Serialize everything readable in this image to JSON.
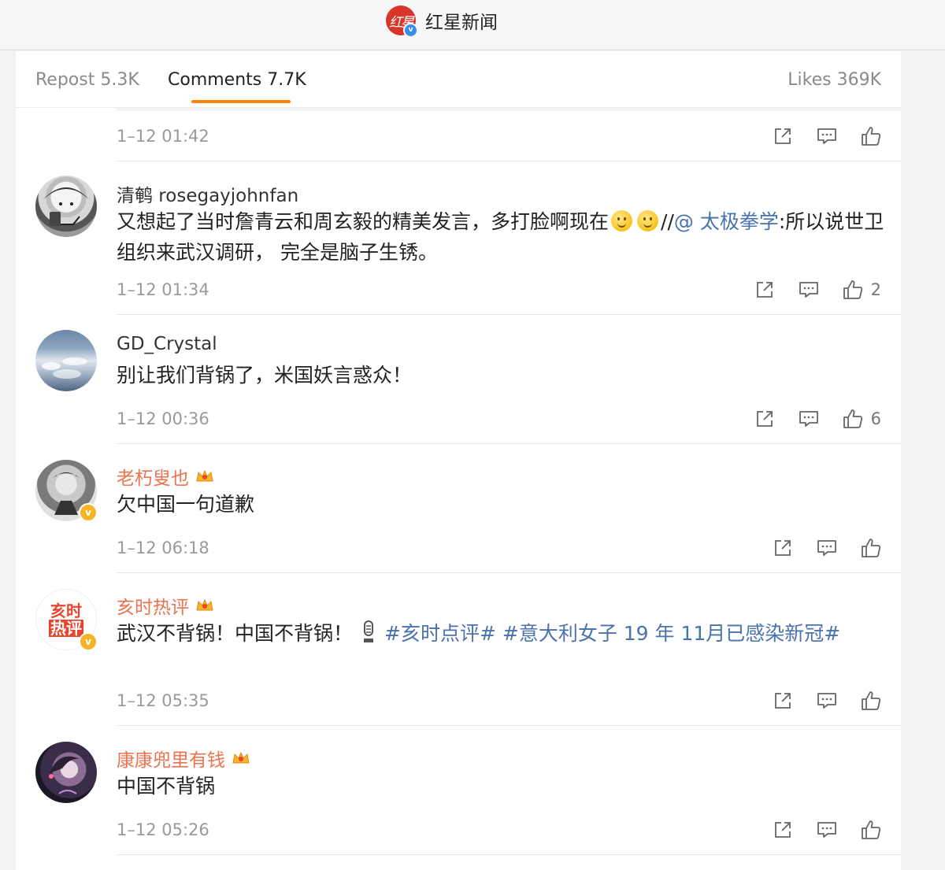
{
  "header": {
    "app_name": "红星新闻",
    "logo_text": "红星",
    "logo_badge": "v"
  },
  "tabs": {
    "repost": "Repost 5.3K",
    "comments": "Comments 7.7K",
    "likes": "Likes 369K",
    "accent_color": "#ff8200"
  },
  "comments": [
    {
      "timestamp": "1–12 01:42",
      "likes": ""
    },
    {
      "username": "清鹌 rosegayjohnfan",
      "text_before": "又想起了当时詹青云和周玄毅的精美发言，多打脸啊现在",
      "emoji": "smile",
      "text_sep": "//",
      "mention": "@ 太极拳学",
      "text_after": ":所以说世卫组织来武汉调研， 完全是脑子生锈。",
      "timestamp": "1–12 01:34",
      "likes": "2"
    },
    {
      "username": "GD_Crystal",
      "text": "别让我们背锅了，米国妖言惑众！",
      "timestamp": "1–12 00:36",
      "likes": "6"
    },
    {
      "username": "老朽叟也",
      "vip": true,
      "verified": true,
      "text": "欠中国一句道歉",
      "timestamp": "1–12 06:18",
      "likes": ""
    },
    {
      "username": "亥时热评",
      "avatar_text_top": "亥时",
      "avatar_text_bottom": "热评",
      "vip": true,
      "verified": true,
      "text": "武汉不背锅！中国不背锅！",
      "hashtag1": "#亥时点评#",
      "hashtag2": "#意大利女子 19 年 11月已感染新冠#",
      "timestamp": "1–12 05:35",
      "likes": ""
    },
    {
      "username": "康康兜里有钱",
      "vip": true,
      "text": "中国不背锅",
      "timestamp": "1–12 05:26",
      "likes": ""
    }
  ],
  "colors": {
    "vip_name": "#eb7350",
    "link": "#4a72ad",
    "brand_red": "#d9362b",
    "verified_gold": "#f6b429"
  }
}
